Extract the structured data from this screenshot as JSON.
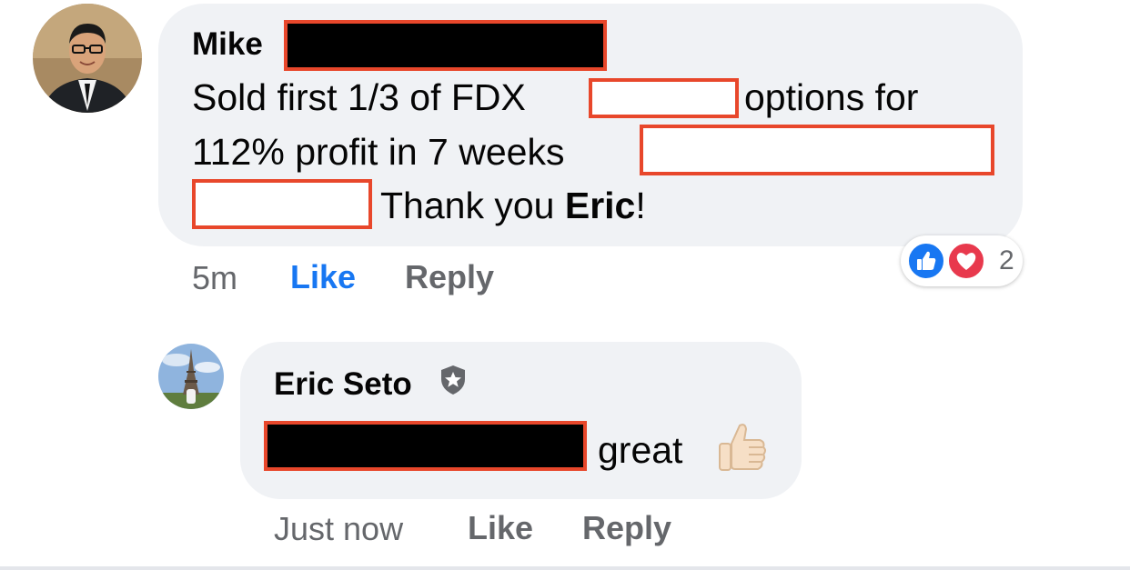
{
  "colors": {
    "bubble": "#f0f2f5",
    "like_blue": "#1877f2",
    "meta_gray": "#65676b",
    "redaction_border": "#e8472b",
    "love_red": "#e8394d"
  },
  "comment": {
    "author": "Mike",
    "line1_a": "Sold first 1/3 of FDX",
    "line1_b": "options for",
    "line2_a": "112% profit in 7 weeks",
    "line3_a": "Thank you",
    "line3_bold": "Eric",
    "line3_end": "!",
    "time": "5m",
    "like_label": "Like",
    "reply_label": "Reply",
    "reactions": {
      "icons": [
        "like-icon",
        "love-icon"
      ],
      "count": "2"
    }
  },
  "reply": {
    "author": "Eric Seto",
    "author_badge_icon": "shield-star-icon",
    "text": "great",
    "emoji_icon": "thumbs-up-emoji-icon",
    "time": "Just now",
    "like_label": "Like",
    "reply_label": "Reply"
  }
}
